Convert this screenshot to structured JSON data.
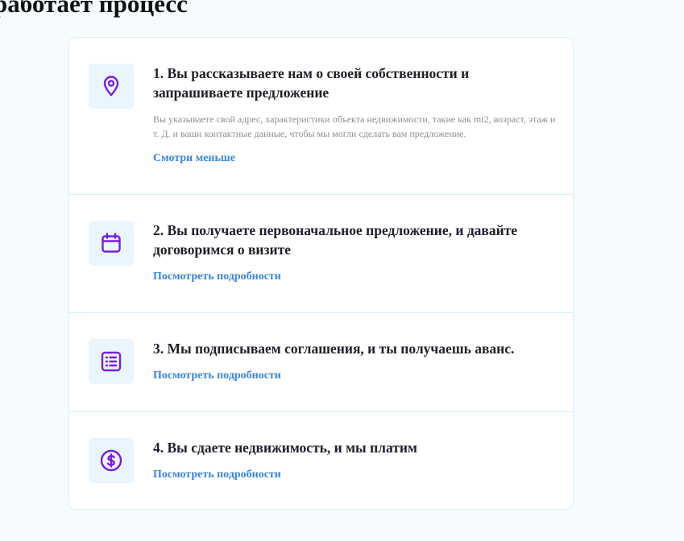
{
  "page": {
    "heading": "работает процесс"
  },
  "steps": [
    {
      "icon": "location-pin-icon",
      "title": "1. Вы рассказываете нам о своей собственности и запрашиваете предложение",
      "description": "Вы указываете свой адрес, характеристики объекта недвижимости, такие как mt2, возраст, этаж и т. Д. и ваши контактные данные, чтобы мы могли сделать вам предложение.",
      "link_label": "Смотри меньше"
    },
    {
      "icon": "calendar-icon",
      "title": "2. Вы получаете первоначальное предложение, и давайте договоримся о визите",
      "link_label": "Посмотреть подробности"
    },
    {
      "icon": "list-icon",
      "title": "3. Мы подписываем соглашения, и ты получаешь аванс.",
      "link_label": "Посмотреть подробности"
    },
    {
      "icon": "dollar-coin-icon",
      "title": "4. Вы сдаете недвижимость, и мы платим",
      "link_label": "Посмотреть подробности"
    }
  ],
  "colors": {
    "icon_accent": "#7b1fd6",
    "link": "#3a86d9",
    "icon_bg": "#eaf6fd",
    "page_bg": "#f5fbfe",
    "border": "#d7eef7"
  }
}
